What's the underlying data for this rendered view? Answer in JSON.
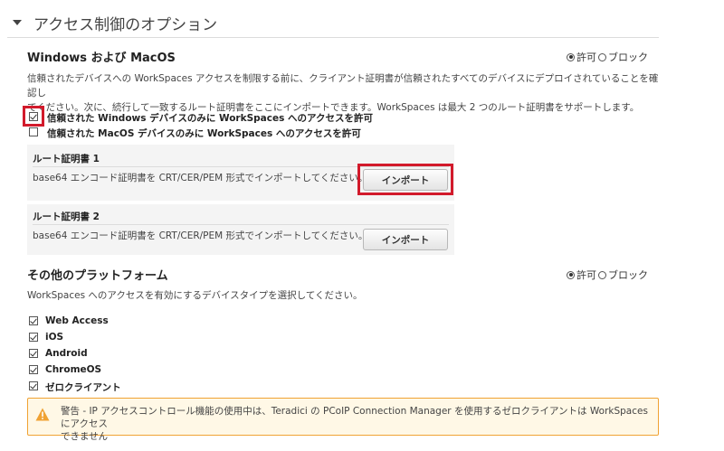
{
  "section": {
    "title": "アクセス制御のオプション"
  },
  "windows_mac": {
    "heading": "Windows および MacOS",
    "radio_allow": "許可",
    "radio_block": "ブロック",
    "description_line1": "信頼されたデバイスへの WorkSpaces アクセスを制限する前に、クライアント証明書が信頼されたすべてのデバイスにデプロイされていることを確認し",
    "description_line2": "てください。次に、続行して一致するルート証明書をここにインポートできます。WorkSpaces は最大 2 つのルート証明書をサポートします。",
    "checkbox_windows": "信頼された Windows デバイスのみに WorkSpaces へのアクセスを許可",
    "checkbox_mac": "信頼された MacOS デバイスのみに WorkSpaces へのアクセスを許可",
    "windows_checked": true,
    "mac_checked": false
  },
  "certs": [
    {
      "title": "ルート証明書 1",
      "desc": "base64 エンコード証明書を CRT/CER/PEM 形式でインポートしてください。",
      "button": "インポート"
    },
    {
      "title": "ルート証明書 2",
      "desc": "base64 エンコード証明書を CRT/CER/PEM 形式でインポートしてください。",
      "button": "インポート"
    }
  ],
  "other": {
    "heading": "その他のプラットフォーム",
    "radio_allow": "許可",
    "radio_block": "ブロック",
    "description": "WorkSpaces へのアクセスを有効にするデバイスタイプを選択してください。",
    "devices": [
      "Web Access",
      "iOS",
      "Android",
      "ChromeOS",
      "ゼロクライアント"
    ],
    "devices_checked": [
      true,
      true,
      true,
      true,
      true
    ]
  },
  "warning": {
    "line1": "警告 - IP アクセスコントロール機能の使用中は、Teradici の PCoIP Connection Manager を使用するゼロクライアントは WorkSpaces にアクセス",
    "line2": "できません",
    "icon": "warning-icon",
    "color_border": "#f0a233",
    "color_bg": "#fff8e6"
  },
  "colors": {
    "highlight": "#d21a2b"
  }
}
